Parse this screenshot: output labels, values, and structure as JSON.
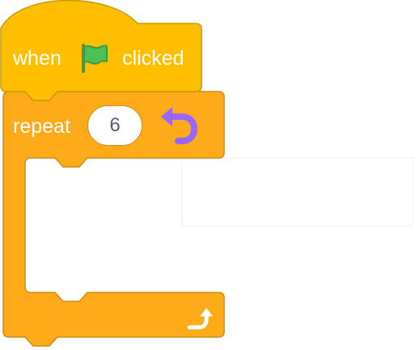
{
  "hat_block": {
    "when_label": "when",
    "flag_icon": "green-flag-icon",
    "clicked_label": "clicked",
    "color": "#FFBF00",
    "border_color": "#CC9900"
  },
  "repeat_block": {
    "label": "repeat",
    "count": "6",
    "header_icon": "rotate-arrow-icon",
    "footer_icon": "loop-arrow-icon",
    "color": "#FFAB19",
    "border_color": "#CF8B17"
  }
}
